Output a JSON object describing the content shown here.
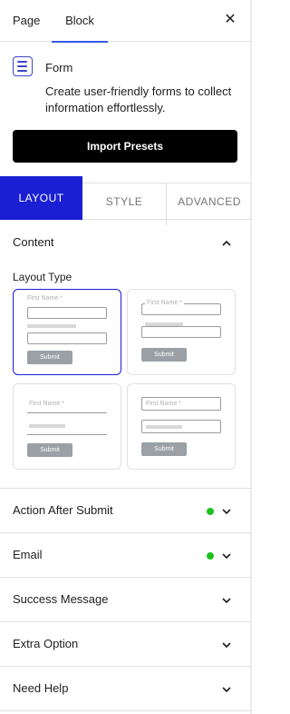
{
  "topbar": {
    "tabs": [
      "Page",
      "Block"
    ],
    "active": "Block",
    "close_icon": "close-icon"
  },
  "block": {
    "icon": "form-icon",
    "title": "Form",
    "description": "Create user-friendly forms to collect information effortlessly."
  },
  "import_button": "Import Presets",
  "tabs": {
    "layout": "LAYOUT",
    "style": "STYLE",
    "advanced": "ADVANCED",
    "active": "LAYOUT"
  },
  "content": {
    "title": "Content",
    "layout_type_label": "Layout Type",
    "presets": [
      {
        "field_label": "First Name *",
        "submit": "Submit",
        "selected": true
      },
      {
        "field_label": "First Name *",
        "submit": "Submit",
        "selected": false
      },
      {
        "field_label": "First Name *",
        "submit": "Submit",
        "selected": false
      },
      {
        "field_label": "First Name *",
        "submit": "Submit",
        "selected": false
      }
    ]
  },
  "panels": [
    {
      "label": "Action After Submit",
      "status_dot": true
    },
    {
      "label": "Email",
      "status_dot": true
    },
    {
      "label": "Success Message",
      "status_dot": false
    },
    {
      "label": "Extra Option",
      "status_dot": false
    },
    {
      "label": "Need Help",
      "status_dot": false
    }
  ],
  "colors": {
    "accent": "#1a1fd4",
    "status_green": "#1ec11e",
    "primary_button": "#000000"
  }
}
